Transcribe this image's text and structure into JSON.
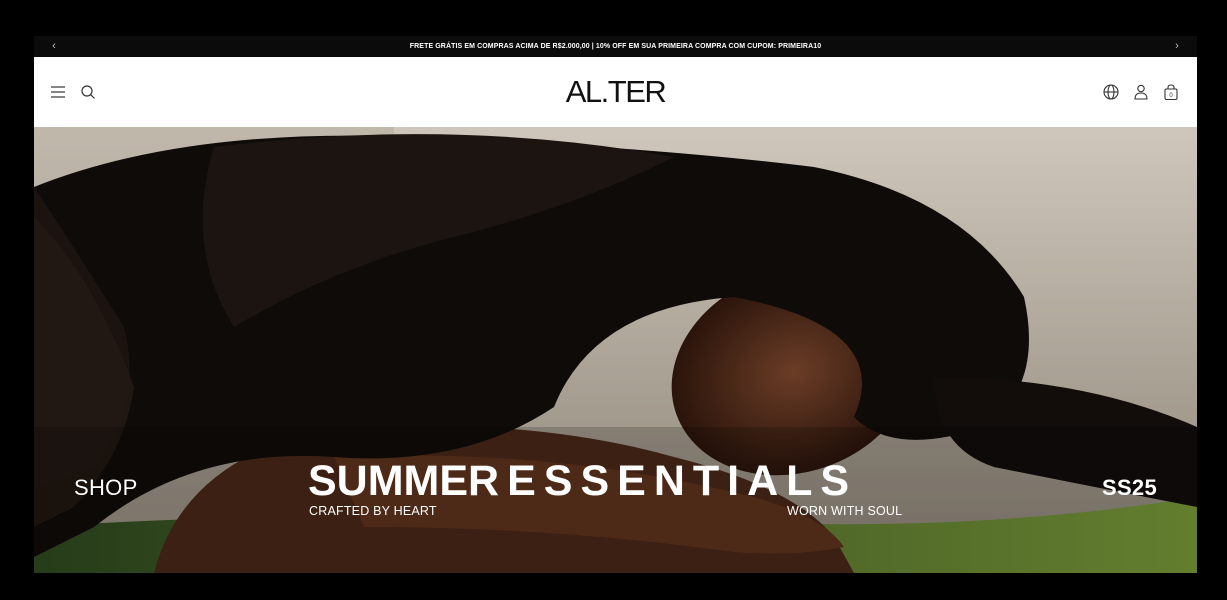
{
  "announcement": {
    "text": "FRETE GRÁTIS EM COMPRAS ACIMA DE R$2.000,00 | 10% OFF EM SUA PRIMEIRA COMPRA COM CUPOM: PRIMEIRA10",
    "prev_icon": "chevron-left-icon",
    "next_icon": "chevron-right-icon"
  },
  "header": {
    "logo": "AL.TER",
    "left_icons": [
      "menu-icon",
      "search-icon"
    ],
    "right_icons": [
      "globe-icon",
      "user-icon",
      "bag-icon"
    ],
    "cart_count": "0"
  },
  "hero": {
    "shop_label": "SHOP",
    "title_part1": "SUMMER",
    "title_part2": "ESSENTIALS",
    "subtitle_left": "CRAFTED BY HEART",
    "subtitle_right": "WORN WITH SOUL",
    "season": "SS25"
  },
  "colors": {
    "announcement_bg": "#0b0b0b",
    "header_bg": "#ffffff",
    "text_light": "#ffffff",
    "logo": "#111111"
  }
}
